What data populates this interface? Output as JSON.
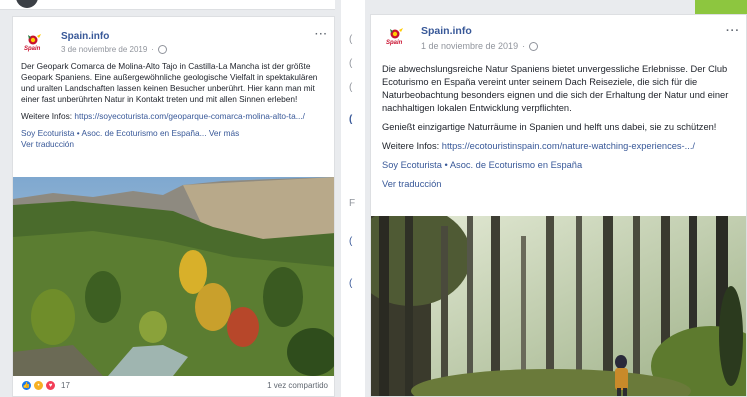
{
  "left_post": {
    "page_name": "Spain.info",
    "logo_text": "Spain",
    "date": "3 de noviembre de 2019",
    "more_menu": "···",
    "text": "Der Geopark Comarca de Molina-Alto Tajo in Castilla-La Mancha ist der größte Geopark Spaniens. Eine außergewöhnliche geologische Vielfalt in spektakulären und uralten Landschaften lassen keinen Besucher unberührt. Hier kann man mit einer fast unberührten Natur in Kontakt treten und mit allen Sinnen erleben!",
    "link_prefix": "Weitere Infos: ",
    "link_url": "https://soyecoturista.com/geoparque-comarca-molina-alto-ta.../",
    "tags": "Soy Ecoturista • Asoc. de Ecoturismo en España...",
    "see_more": "Ver más",
    "see_translation": "Ver traducción",
    "reaction_count": "17",
    "shares": "1 vez compartido"
  },
  "right_post": {
    "page_name": "Spain.info",
    "logo_text": "Spain",
    "date": "1 de noviembre de 2019",
    "more_menu": "···",
    "text_1": "Die abwechslungsreiche Natur Spaniens bietet unvergessliche Erlebnisse. Der Club Ecoturismo en España vereint unter seinem Dach Reiseziele, die sich für die Naturbeobachtung besonders eignen und die sich der Erhaltung der Natur und einer nachhaltigen lokalen Entwicklung verpflichten.",
    "text_2": "Genießt einzigartige Naturräume in Spanien und helft uns dabei, sie zu schützen!",
    "link_prefix": "Weitere Infos: ",
    "link_url": "https://ecotouristinspain.com/nature-watching-experiences-.../",
    "tags": "Soy Ecoturista • Asoc. de Ecoturismo en España",
    "see_translation": "Ver traducción"
  },
  "colors": {
    "link": "#385898",
    "background": "#e9ebee",
    "accent_green": "#8dc63f"
  }
}
